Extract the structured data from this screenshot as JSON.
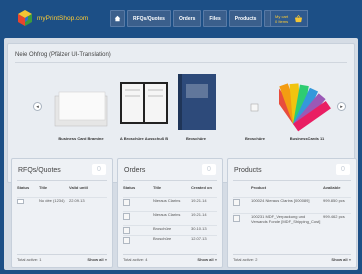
{
  "brand": {
    "name": "myPrintShop.com"
  },
  "nav": {
    "home_icon": "home-icon",
    "items": [
      {
        "label": "RFQs/Quotes"
      },
      {
        "label": "Orders"
      },
      {
        "label": "Files"
      },
      {
        "label": "Products"
      }
    ],
    "user_icon": "user-icon",
    "user_caret": "▾"
  },
  "cart": {
    "line1": "My cart",
    "line2": "0 Items",
    "icon": "basket-icon"
  },
  "carousel": {
    "title": "Neie Ohfrog (Pfälzer UI-Translation)",
    "prev_glyph": "◂",
    "next_glyph": "▸",
    "products": [
      {
        "caption": "Business Card Bramine",
        "image": "business-card-image"
      },
      {
        "caption": "A Broschüre Ausschuß B",
        "image": "brochure-book-image"
      },
      {
        "caption": "Broschüre",
        "image": "brochure-cover-image"
      },
      {
        "caption": "Broschüre",
        "image": "broken-image"
      },
      {
        "caption": "BusinessCards 11",
        "image": "color-fan-image"
      }
    ]
  },
  "rfq": {
    "title": "RFQs/Quotes",
    "count": "0",
    "headers": [
      "Status",
      "Title",
      "Valid until"
    ],
    "rows": [
      {
        "title": "Nu dée (1234)",
        "valid": "22.09.13"
      }
    ],
    "total": "Total active: 1",
    "show_all": "Show all"
  },
  "orders": {
    "title": "Orders",
    "count": "0",
    "headers": [
      "Status",
      "Title",
      "Created on"
    ],
    "rows": [
      {
        "title": "Nieraus Clarins",
        "created": "19.21.14"
      },
      {
        "title": "Nieraus Clarins",
        "created": "19.21.14"
      },
      {
        "title": "Broschüre",
        "created": "30.10.13"
      },
      {
        "title": "Broschüre",
        "created": "12.07.13"
      }
    ],
    "total": "Total active: 4",
    "show_all": "Show all"
  },
  "products": {
    "title": "Products",
    "count": "0",
    "headers": [
      "Product",
      "Available"
    ],
    "rows": [
      {
        "name": "100024 Nieraus Clarins [000089]",
        "available": "999.850 pcs"
      },
      {
        "name": "100231 MDF_Verpackung und Versands Fonde [MDF_Shipping_Cost]",
        "available": "999.462 pcs"
      }
    ],
    "total": "Total active: 2",
    "show_all": "Show all"
  },
  "colors": {
    "header_bg": "#1c4f86",
    "accent": "#ffcc33"
  }
}
